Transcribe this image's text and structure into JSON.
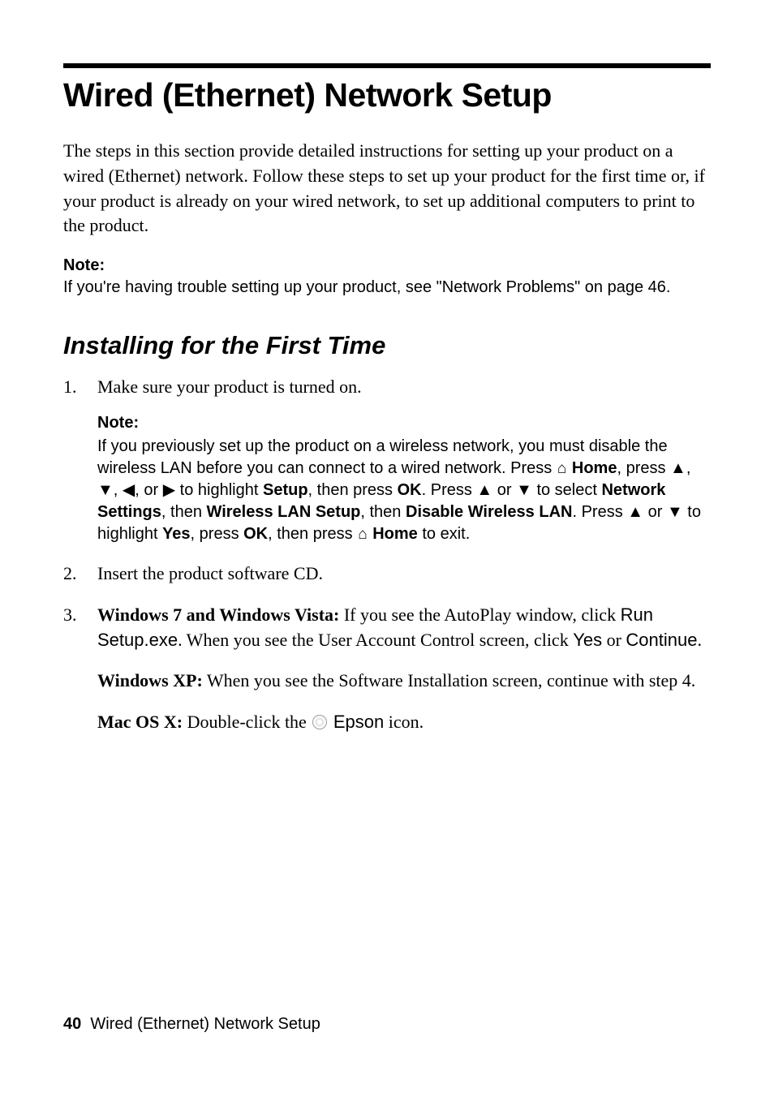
{
  "title": "Wired (Ethernet) Network Setup",
  "intro": "The steps in this section provide detailed instructions for setting up your product on a wired (Ethernet) network. Follow these steps to set up your product for the first time or, if your product is already on your wired network, to set up additional computers to print to the product.",
  "note_label": "Note:",
  "note_text": "If you're having trouble setting up your product, see \"Network Problems\" on page 46.",
  "section_title": "Installing for the First Time",
  "steps": [
    {
      "text": "Make sure your product is turned on.",
      "subnote_label": "Note:",
      "subnote_pre": "If you previously set up the product on a wireless network, you must disable the wireless LAN before you can connect to a wired network. Press ",
      "home1": "Home",
      "subnote_mid1": ", press ▲, ▼, ◀, or  ▶ to highlight ",
      "setup_lbl": "Setup",
      "subnote_mid2": ", then press ",
      "ok1": "OK",
      "subnote_mid3": ". Press ▲ or ▼ to select ",
      "netset": "Network Settings",
      "subnote_mid4": ", then ",
      "wlan": "Wireless LAN Setup",
      "subnote_mid5": ", then ",
      "disable": "Disable Wireless LAN",
      "subnote_mid6": ". Press ▲ or ▼ to highlight ",
      "yes": "Yes",
      "subnote_mid7": ", press ",
      "ok2": "OK",
      "subnote_mid8": ", then press ",
      "home2": "Home",
      "subnote_end": " to exit."
    },
    {
      "text": "Insert the product software CD."
    },
    {
      "win7_label": "Windows 7 and Windows Vista:",
      "win7_text1": " If you see the AutoPlay window, click ",
      "run": "Run Setup.exe",
      "win7_text2": ". When you see the User Account Control screen, click ",
      "yes_btn": "Yes",
      "win7_text3": " or ",
      "continue_btn": "Continue",
      "win7_text4": ".",
      "xp_label": "Windows XP:",
      "xp_text": " When you see the Software Installation screen, continue with step 4.",
      "mac_label": "Mac OS X:",
      "mac_text1": " Double-click the ",
      "epson": "Epson",
      "mac_text2": " icon."
    }
  ],
  "footer": {
    "page": "40",
    "title": "Wired (Ethernet) Network Setup"
  }
}
